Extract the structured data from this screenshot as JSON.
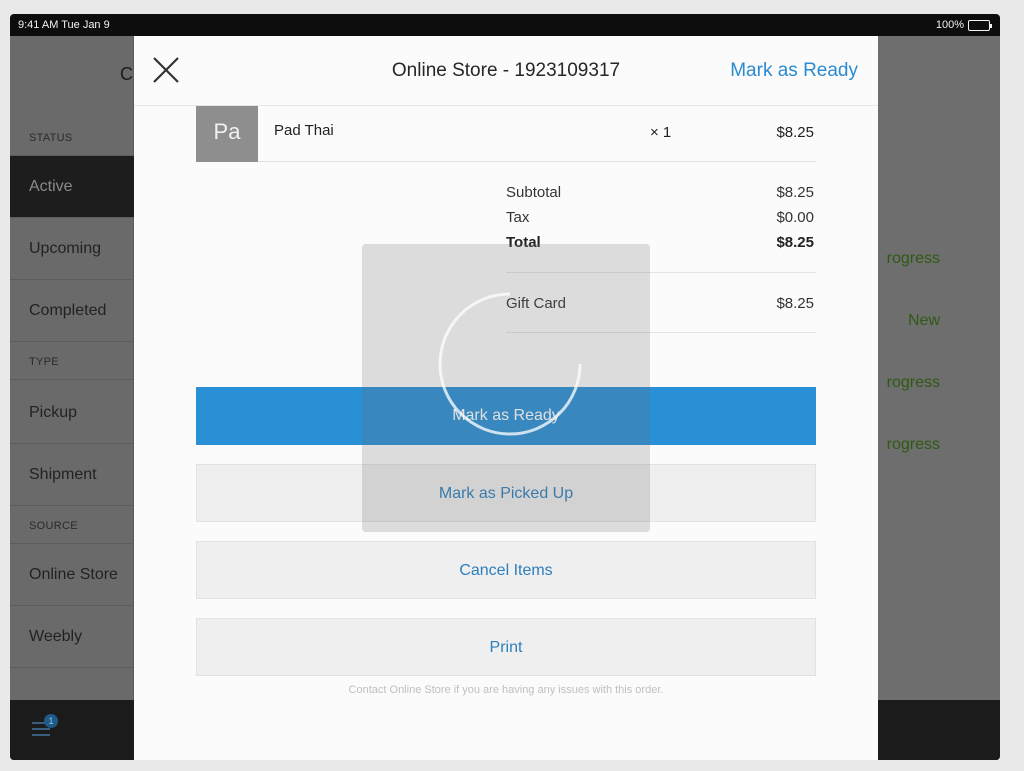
{
  "status_bar": {
    "time": "9:41 AM  Tue Jan 9",
    "battery": "100%"
  },
  "background_app": {
    "header_partial": "C",
    "sidebar": {
      "sections": [
        {
          "label": "STATUS",
          "items": [
            "Active",
            "Upcoming",
            "Completed"
          ]
        },
        {
          "label": "TYPE",
          "items": [
            "Pickup",
            "Shipment"
          ]
        },
        {
          "label": "SOURCE",
          "items": [
            "Online Store",
            "Weebly"
          ]
        }
      ],
      "active_item": "Active"
    },
    "right_statuses": [
      "rogress",
      "New",
      "rogress",
      "rogress"
    ],
    "menu_badge": "1"
  },
  "modal": {
    "title": "Online Store - 1923109317",
    "header_action": "Mark as Ready",
    "line_item": {
      "avatar": "Pa",
      "name": "Pad Thai",
      "qty": "× 1",
      "price": "$8.25"
    },
    "totals": {
      "subtotal_label": "Subtotal",
      "subtotal": "$8.25",
      "tax_label": "Tax",
      "tax": "$0.00",
      "total_label": "Total",
      "total": "$8.25",
      "payment_label": "Gift Card",
      "payment": "$8.25"
    },
    "buttons": {
      "mark_ready": "Mark as Ready",
      "mark_picked_up": "Mark as Picked Up",
      "cancel_items": "Cancel Items",
      "print": "Print"
    },
    "contact_note": "Contact Online Store if you are having any issues with this order."
  },
  "colors": {
    "accent": "#2a90d6",
    "link": "#2a8bd0",
    "status_green": "#2e5a12"
  }
}
